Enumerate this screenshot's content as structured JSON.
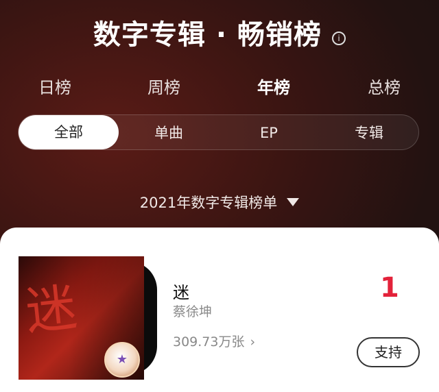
{
  "header": {
    "title": "数字专辑 · 畅销榜",
    "info_icon": "info-icon"
  },
  "period_tabs": [
    {
      "label": "日榜",
      "active": false
    },
    {
      "label": "周榜",
      "active": false
    },
    {
      "label": "年榜",
      "active": true
    },
    {
      "label": "总榜",
      "active": false
    }
  ],
  "type_segments": [
    {
      "label": "全部",
      "active": true
    },
    {
      "label": "单曲",
      "active": false
    },
    {
      "label": "EP",
      "active": false
    },
    {
      "label": "专辑",
      "active": false
    }
  ],
  "year_selector": {
    "label": "2021年数字专辑榜单",
    "icon": "caret-down-icon"
  },
  "entries": [
    {
      "rank": "1",
      "title": "迷",
      "artist": "蔡徐坤",
      "sales": "309.73万张",
      "button_label": "支持",
      "cover_text": "迷"
    }
  ],
  "colors": {
    "accent": "#e3223a",
    "background": "#2a1412"
  }
}
